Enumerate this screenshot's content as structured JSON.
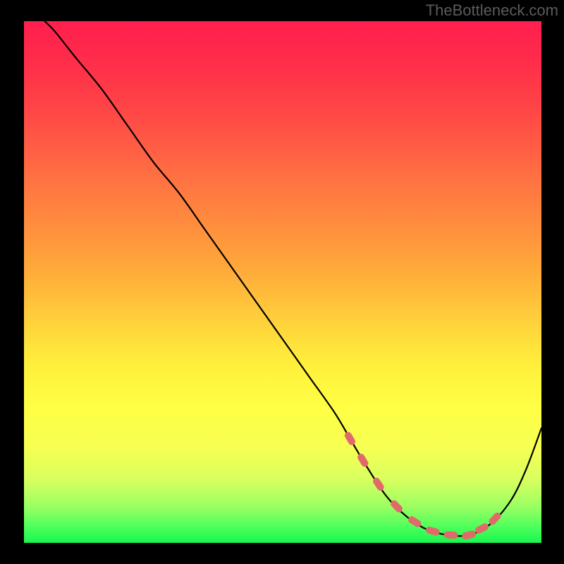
{
  "watermark": "TheBottleneck.com",
  "chart_data": {
    "type": "line",
    "title": "",
    "xlabel": "",
    "ylabel": "",
    "xlim": [
      0,
      100
    ],
    "ylim": [
      0,
      100
    ],
    "series": [
      {
        "name": "bottleneck-curve",
        "x": [
          4,
          6,
          10,
          15,
          20,
          25,
          30,
          35,
          40,
          45,
          50,
          55,
          60,
          63,
          66,
          70,
          74,
          78,
          82,
          86,
          90,
          94,
          97,
          100
        ],
        "y": [
          100,
          98,
          93,
          87,
          80,
          73,
          67,
          60,
          53,
          46,
          39,
          32,
          25,
          20,
          15,
          9,
          5,
          2.5,
          1.5,
          1.5,
          3.5,
          8,
          14,
          22
        ]
      }
    ],
    "optimal_range_x": [
      63,
      90
    ],
    "annotations": [
      {
        "text": "optimal-zone-markers",
        "x_from": 63,
        "x_to": 90
      }
    ]
  },
  "colors": {
    "dash": "#e06a6a",
    "curve": "#000000",
    "gradient_top": "#ff1f4e",
    "gradient_bottom": "#19f74e"
  }
}
